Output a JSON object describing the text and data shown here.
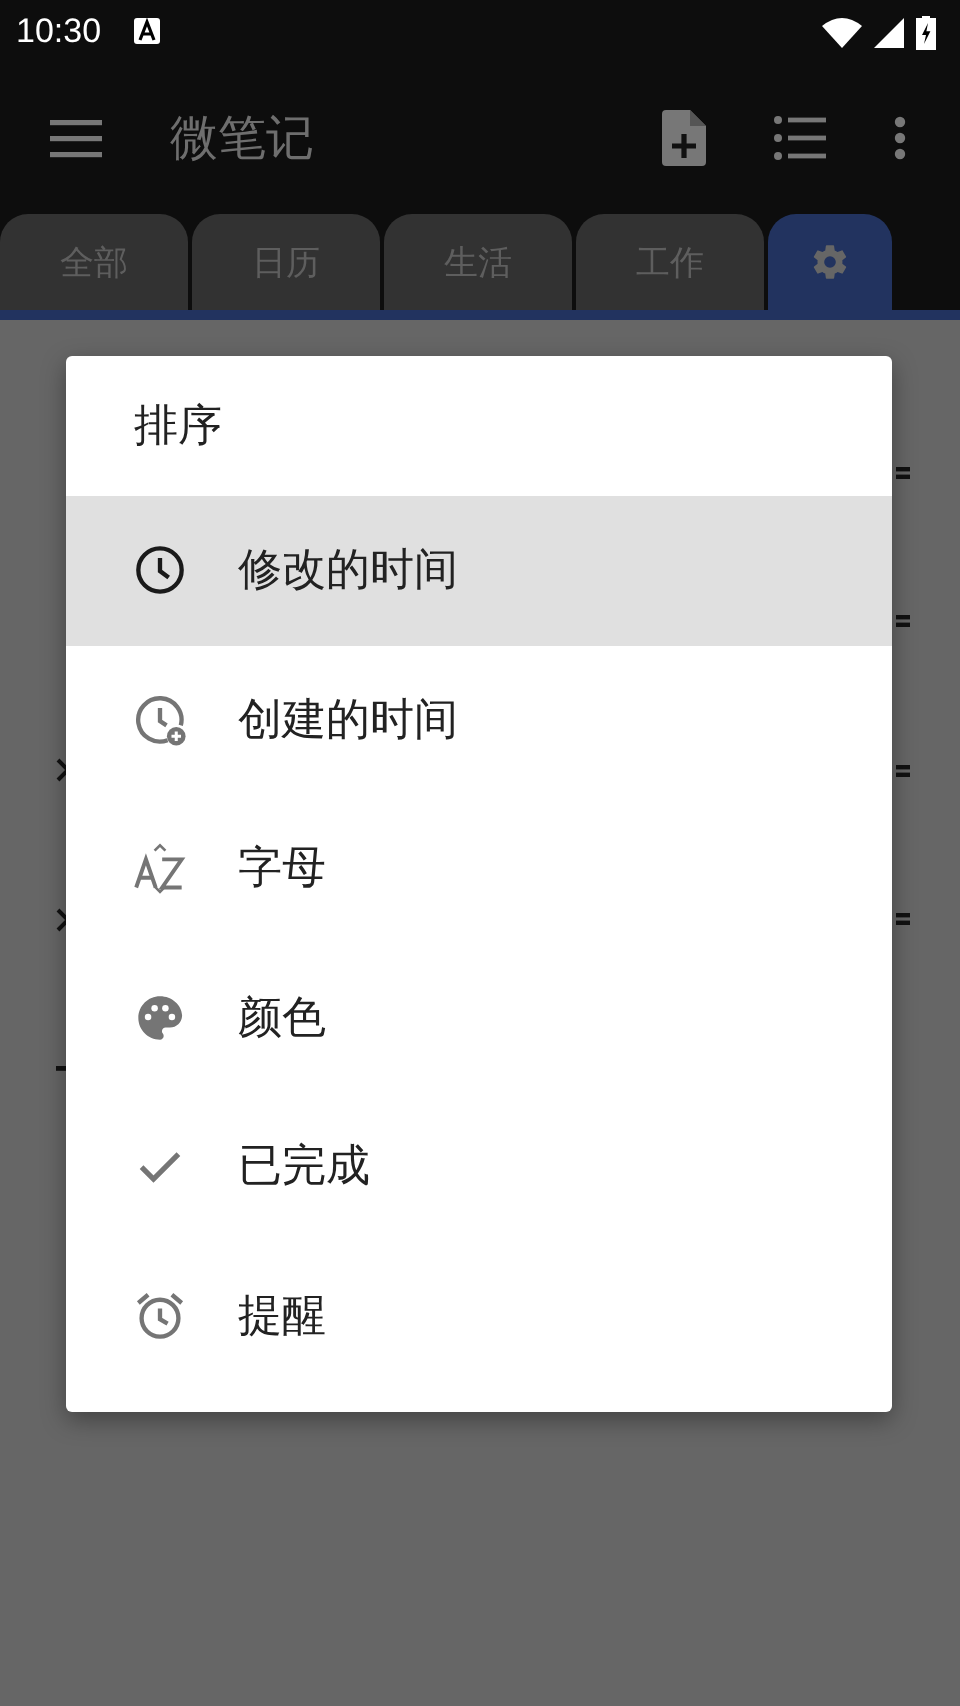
{
  "status_bar": {
    "time": "10:30"
  },
  "app_bar": {
    "title": "微笔记"
  },
  "tabs": [
    {
      "kind": "text",
      "label": "全部",
      "selected": false
    },
    {
      "kind": "text",
      "label": "日历",
      "selected": false
    },
    {
      "kind": "text",
      "label": "生活",
      "selected": false
    },
    {
      "kind": "text",
      "label": "工作",
      "selected": false
    },
    {
      "kind": "icon",
      "selected": true
    }
  ],
  "sort_dialog": {
    "title": "排序",
    "options": [
      {
        "label": "修改的时间",
        "selected": true
      },
      {
        "label": "创建的时间",
        "selected": false
      },
      {
        "label": "字母",
        "selected": false
      },
      {
        "label": "颜色",
        "selected": false
      },
      {
        "label": "已完成",
        "selected": false
      },
      {
        "label": "提醒",
        "selected": false
      }
    ]
  }
}
